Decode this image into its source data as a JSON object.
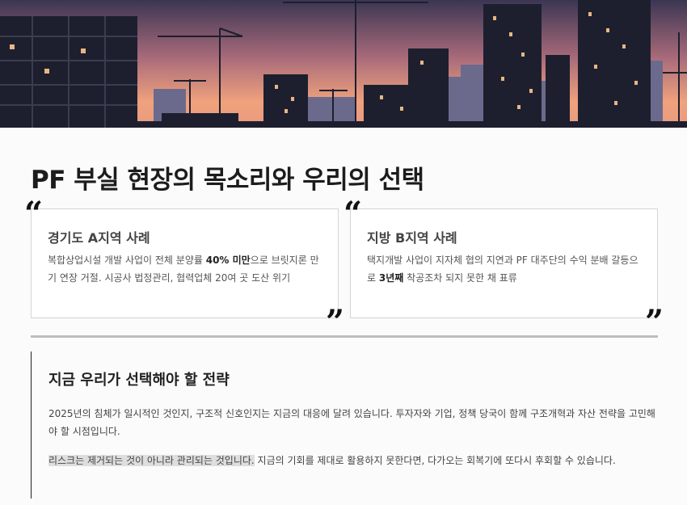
{
  "hero": {
    "image": "construction-cranes-sunset-skyline",
    "sky_top": "#3b3653",
    "sky_mid": "#c77a7c",
    "sky_glow": "#f0a27c",
    "silhouette": "#1d1f2e"
  },
  "page": {
    "title": "PF 부실 현장의 목소리와 우리의 선택"
  },
  "cases": [
    {
      "title": "경기도 A지역 사례",
      "text_1": "복합상업시설 개발 사업이 전체 분양률 ",
      "bold": "40% 미만",
      "text_2": "으로 브릿지론 만기 연장 거절. 시공사 법정관리, 협력업체 20여 곳 도산 위기"
    },
    {
      "title": "지방 B지역 사례",
      "text_1": "택지개발 사업이 지자체 협의 지연과 PF 대주단의 수익 분배 갈등으로 ",
      "bold": "3년째",
      "text_2": " 착공조차 되지 못한 채 표류"
    }
  ],
  "quotes": {
    "open": "“",
    "close": "”"
  },
  "strategy": {
    "title": "지금 우리가 선택해야 할 전략",
    "paragraph_1": "2025년의 침체가 일시적인 것인지, 구조적 신호인지는 지금의 대응에 달려 있습니다. 투자자와 기업, 정책 당국이 함께 구조개혁과 자산 전략을 고민해야 할 시점입니다.",
    "highlight": "리스크는 제거되는 것이 아니라 관리되는 것입니다.",
    "paragraph_2_rest": " 지금의 기회를 제대로 활용하지 못한다면, 다가오는 회복기에 또다시 후회할 수 있습니다."
  }
}
